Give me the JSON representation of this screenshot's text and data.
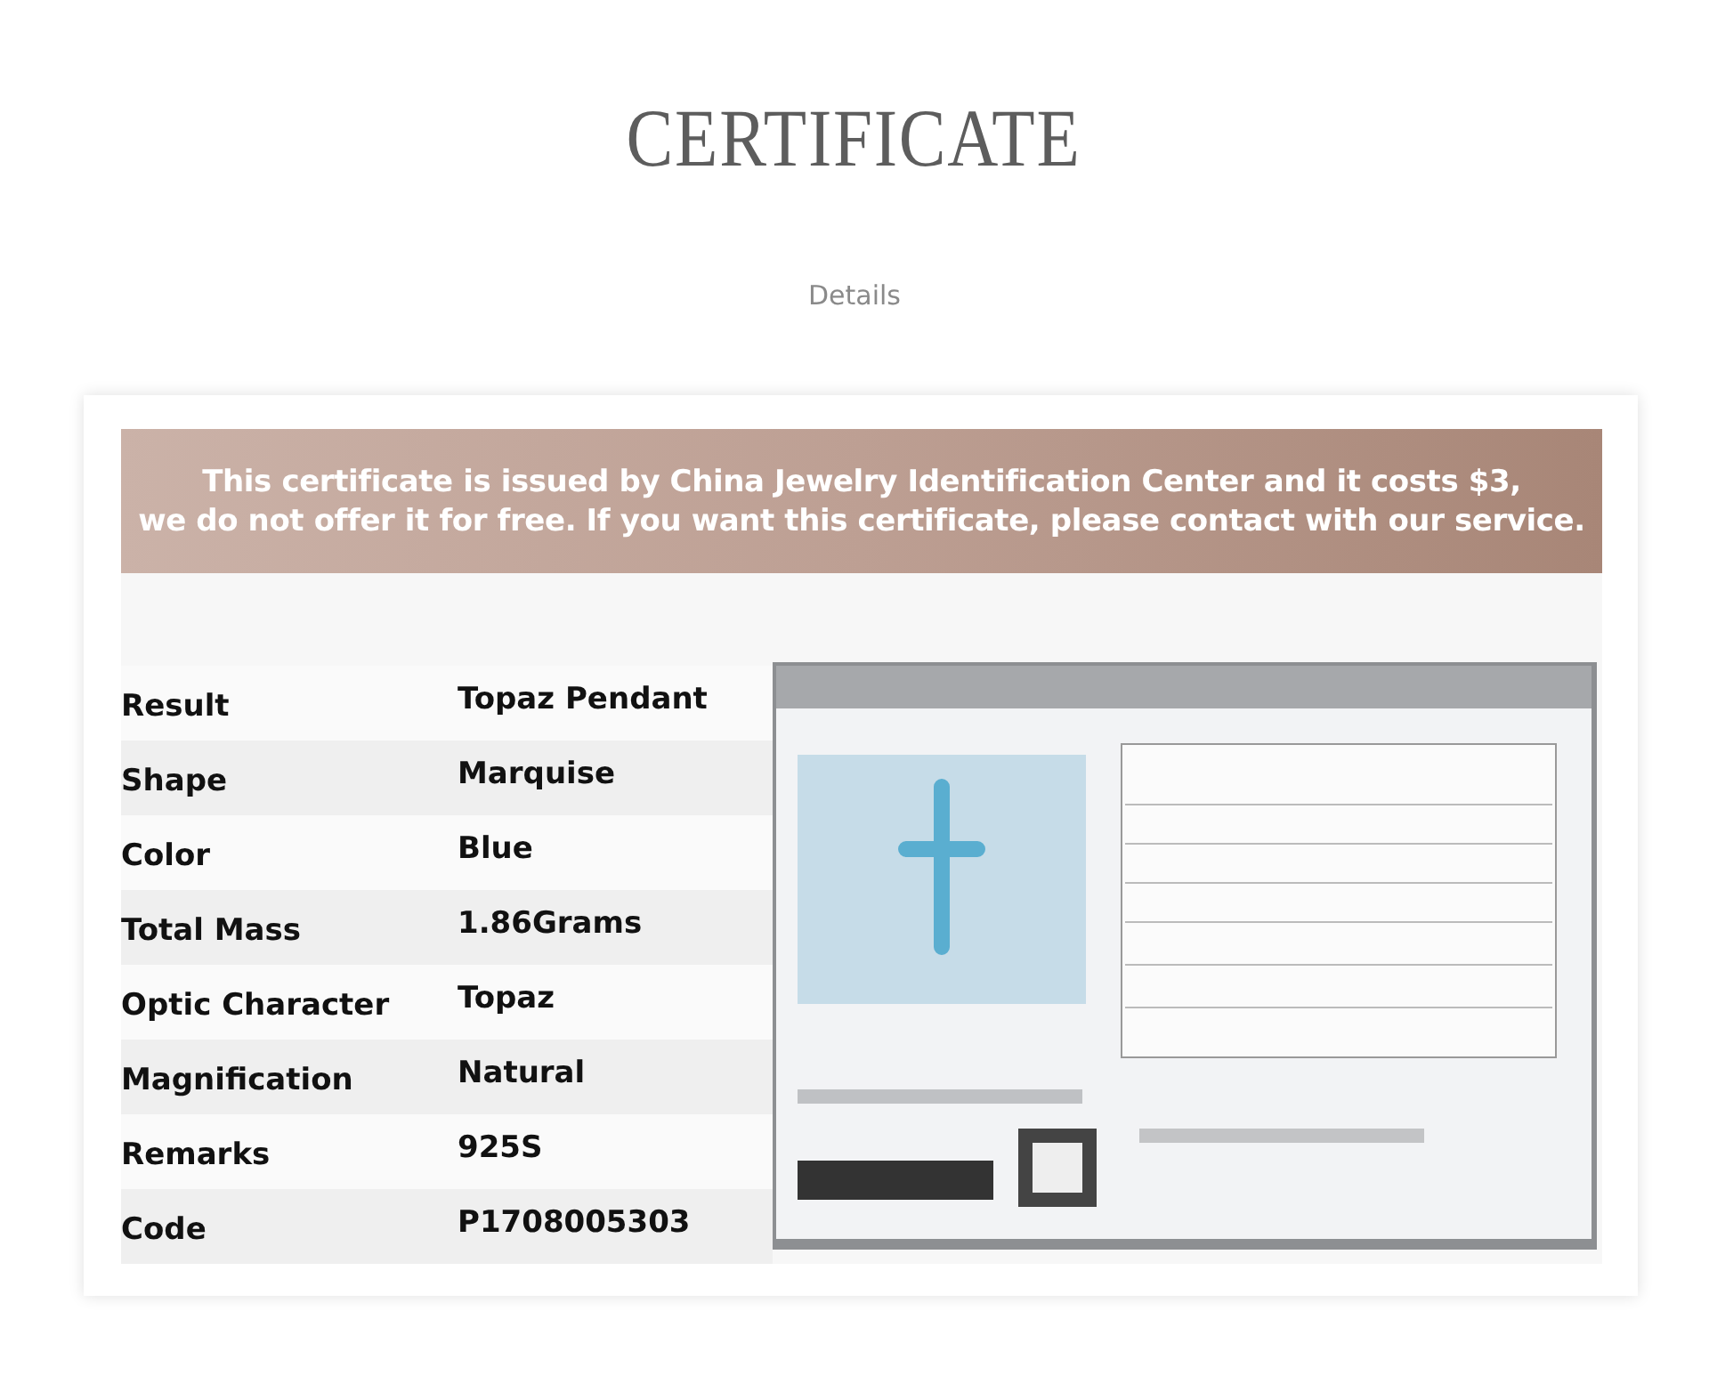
{
  "header": {
    "title": "CERTIFICATE",
    "subtitle": "Details"
  },
  "notice": {
    "lines": [
      "This certificate is issued by China Jewelry Identification Center and it costs $3,",
      "we do not offer it for free. If you want this certificate, please contact with our service."
    ]
  },
  "specs": [
    {
      "label": "Result",
      "value": "Topaz Pendant"
    },
    {
      "label": "Shape",
      "value": "Marquise"
    },
    {
      "label": "Color",
      "value": "Blue"
    },
    {
      "label": "Total Mass",
      "value": "1.86Grams"
    },
    {
      "label": "Optic Character",
      "value": "Topaz"
    },
    {
      "label": "Magnification",
      "value": "Natural"
    },
    {
      "label": "Remarks",
      "value": "925S"
    },
    {
      "label": "Code",
      "value": "P1708005303"
    }
  ]
}
